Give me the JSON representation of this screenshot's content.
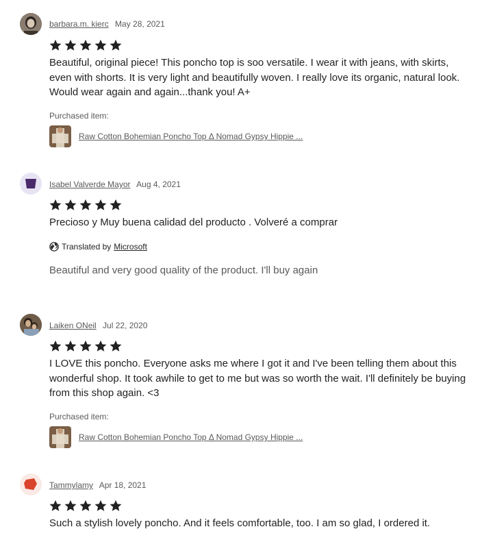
{
  "reviews": [
    {
      "username": "barbara.m. kierc",
      "date": "May 28, 2021",
      "rating": 5,
      "text": "Beautiful, original piece! This poncho top is soo versatile. I wear it with jeans, with skirts, even with shorts. It is very light and beautifully woven. I really love its organic, natural look. Would wear again and again...thank you! A+",
      "purchased_label": "Purchased item:",
      "item_title": "Raw Cotton Bohemian Poncho Top Δ Nomad Gypsy Hippie ..."
    },
    {
      "username": "Isabel Valverde Mayor",
      "date": "Aug 4, 2021",
      "rating": 5,
      "text": "Precioso y Muy buena calidad del producto . Volveré a comprar",
      "translated_by": "Translated by",
      "translation_provider": "Microsoft",
      "translation": "Beautiful and very good quality of the product. I'll buy again"
    },
    {
      "username": "Laiken ONeil",
      "date": "Jul 22, 2020",
      "rating": 5,
      "text": "I LOVE this poncho. Everyone asks me where I got it and I've been telling them about this wonderful shop. It took awhile to get to me but was so worth the wait. I'll definitely be buying from this shop again. <3",
      "purchased_label": "Purchased item:",
      "item_title": "Raw Cotton Bohemian Poncho Top Δ Nomad Gypsy Hippie ..."
    },
    {
      "username": "Tammylamy",
      "date": "Apr 18, 2021",
      "rating": 5,
      "text": "Such a stylish lovely poncho. And it feels comfortable, too. I am so glad, I ordered it."
    }
  ],
  "icons": {
    "star": "star-icon",
    "globe": "globe-icon"
  },
  "colors": {
    "star": "#222222",
    "muted_text": "#595959",
    "avatar_purple_bg": "#e8e3f3",
    "avatar_purple": "#4b2a6b",
    "avatar_red_bg": "#fbe9e5",
    "avatar_red": "#d9432b"
  }
}
